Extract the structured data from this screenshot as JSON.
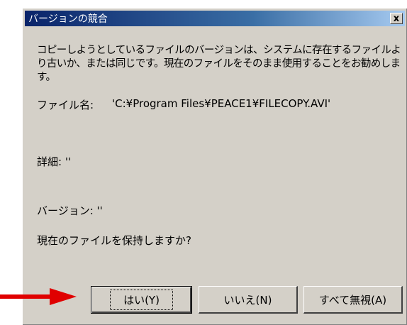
{
  "dialog": {
    "title": "バージョンの競合",
    "close_label": "x",
    "message": "コピーしようとしているファイルのバージョンは、システムに存在するファイルより古いか、または同じです。現在のファイルをそのまま使用することをお勧めします。",
    "file_name_label": "ファイル名:",
    "file_name_value": "'C:¥Program Files¥PEACE1¥FILECOPY.AVI'",
    "details_label": "詳細: ''",
    "version_label": "バージョン: ''",
    "question": "現在のファイルを保持しますか?",
    "buttons": {
      "yes": "はい(Y)",
      "no": "いいえ(N)",
      "ignore_all": "すべて無視(A)"
    }
  },
  "annotation": {
    "arrow_color": "#e00000",
    "arrow_icon": "arrow-right-icon"
  }
}
